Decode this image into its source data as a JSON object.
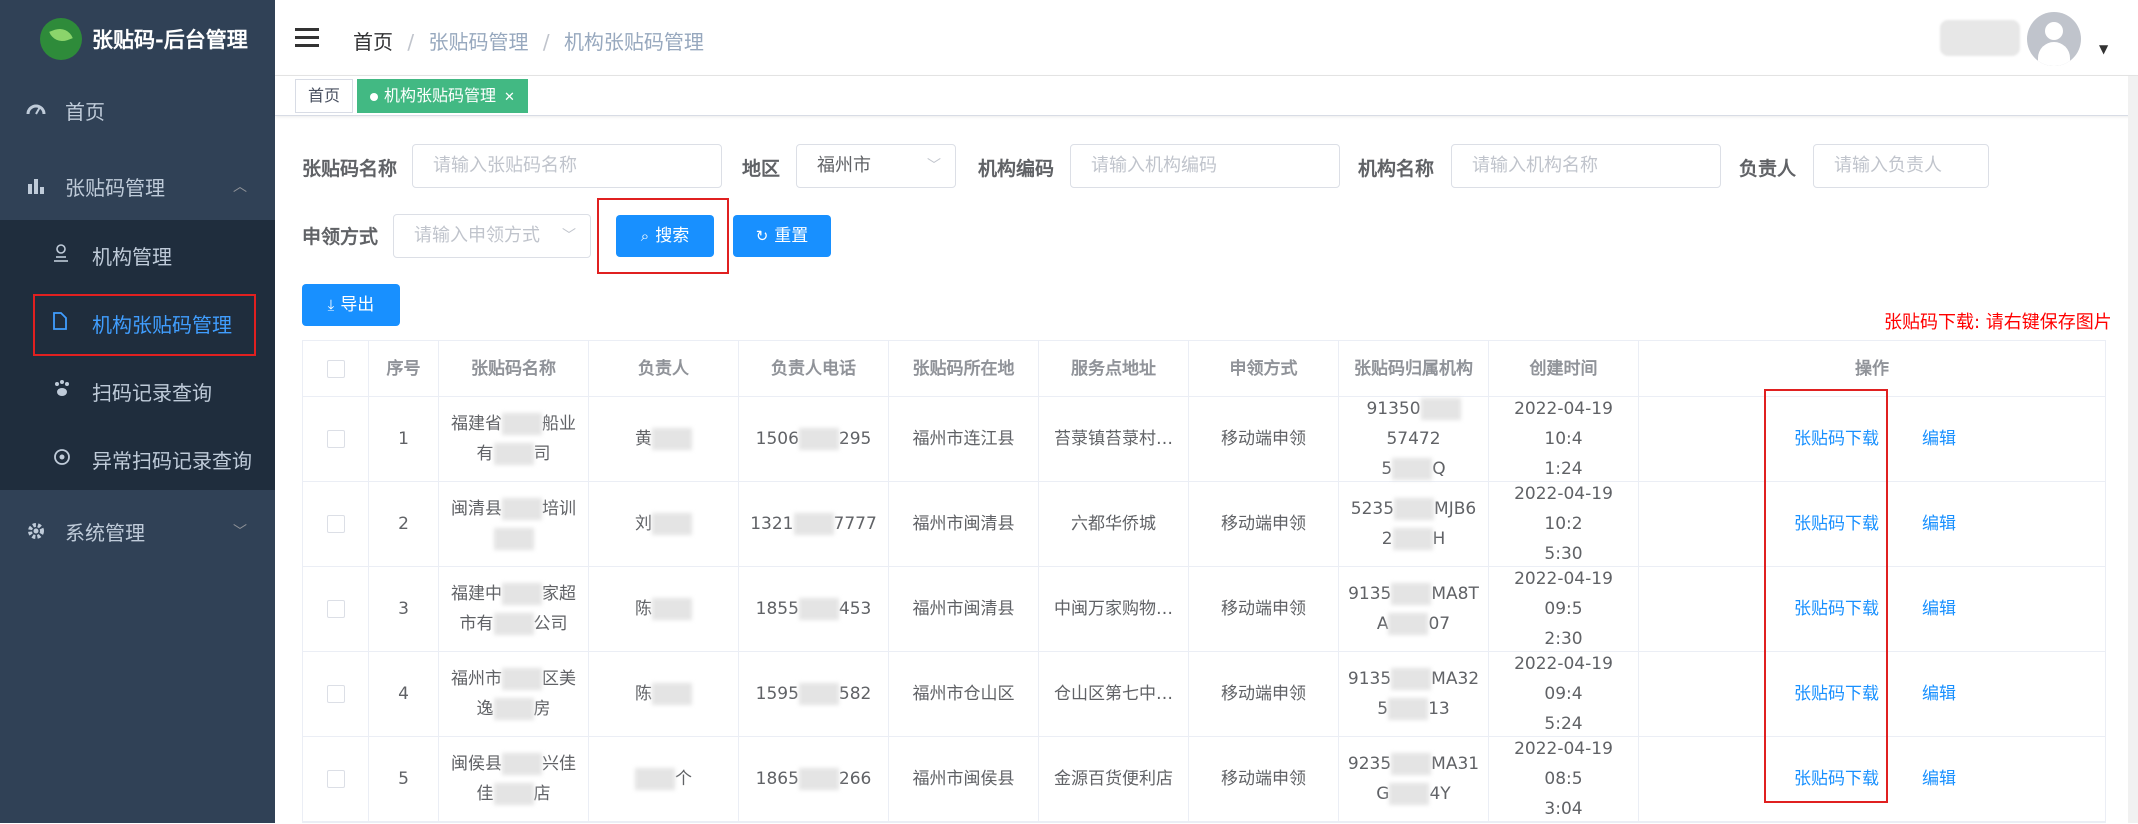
{
  "app": {
    "title": "张贴码-后台管理"
  },
  "sidebar": {
    "items": [
      {
        "label": "首页",
        "icon": "dashboard-icon"
      },
      {
        "label": "张贴码管理",
        "icon": "bar-chart-icon",
        "expanded": true
      },
      {
        "label": "系统管理",
        "icon": "gear-icon"
      }
    ],
    "subitems": [
      {
        "label": "机构管理",
        "icon": "user-icon"
      },
      {
        "label": "机构张贴码管理",
        "icon": "document-icon",
        "active": true
      },
      {
        "label": "扫码记录查询",
        "icon": "paw-icon"
      },
      {
        "label": "异常扫码记录查询",
        "icon": "scan-icon"
      }
    ]
  },
  "header": {
    "breadcrumb": [
      "首页",
      "张贴码管理",
      "机构张贴码管理"
    ]
  },
  "tags": [
    {
      "label": "首页"
    },
    {
      "label": "机构张贴码管理",
      "active": true
    }
  ],
  "form": {
    "name_label": "张贴码名称",
    "name_placeholder": "请输入张贴码名称",
    "region_label": "地区",
    "region_value": "福州市",
    "code_label": "机构编码",
    "code_placeholder": "请输入机构编码",
    "org_label": "机构名称",
    "org_placeholder": "请输入机构名称",
    "person_label": "负责人",
    "person_placeholder": "请输入负责人",
    "apply_label": "申领方式",
    "apply_placeholder": "请输入申领方式",
    "search_btn": "搜索",
    "reset_btn": "重置",
    "export_btn": "导出"
  },
  "notice": "张贴码下载: 请右键保存图片",
  "table": {
    "columns": [
      "序号",
      "张贴码名称",
      "负责人",
      "负责人电话",
      "张贴码所在地",
      "服务点地址",
      "申领方式",
      "张贴码归属机构",
      "创建时间",
      "操作"
    ],
    "download_label": "张贴码下载",
    "edit_label": "编辑",
    "rows": [
      {
        "no": "1",
        "name1": "福建省",
        "name2": "船业",
        "name3": "有",
        "name4": "司",
        "person1": "黄",
        "person2": "",
        "phone1": "1506",
        "phone2": "295",
        "location": "福州市连江县",
        "address": "苔菉镇苔菉村…",
        "apply": "移动端申领",
        "org1": "91350",
        "org2": "57472",
        "org3": "5",
        "org4": "Q",
        "time1": "2022-04-19 10:4",
        "time2": "1:24"
      },
      {
        "no": "2",
        "name1": "闽清县",
        "name2": "培训",
        "name3": "",
        "name4": "",
        "person1": "刘",
        "person2": "",
        "phone1": "1321",
        "phone2": "7777",
        "location": "福州市闽清县",
        "address": "六都华侨城",
        "apply": "移动端申领",
        "org1": "5235",
        "org2": "MJB6",
        "org3": "2",
        "org4": "H",
        "time1": "2022-04-19 10:2",
        "time2": "5:30"
      },
      {
        "no": "3",
        "name1": "福建中",
        "name2": "家超",
        "name3": "市有",
        "name4": "公司",
        "person1": "陈",
        "person2": "",
        "phone1": "1855",
        "phone2": "453",
        "location": "福州市闽清县",
        "address": "中闽万家购物…",
        "apply": "移动端申领",
        "org1": "9135",
        "org2": "MA8T",
        "org3": "A",
        "org4": "07",
        "time1": "2022-04-19 09:5",
        "time2": "2:30"
      },
      {
        "no": "4",
        "name1": "福州市",
        "name2": "区美",
        "name3": "逸",
        "name4": "房",
        "person1": "陈",
        "person2": "",
        "phone1": "1595",
        "phone2": "582",
        "location": "福州市仓山区",
        "address": "仓山区第七中…",
        "apply": "移动端申领",
        "org1": "9135",
        "org2": "MA32",
        "org3": "5",
        "org4": "13",
        "time1": "2022-04-19 09:4",
        "time2": "5:24"
      },
      {
        "no": "5",
        "name1": "闽侯县",
        "name2": "兴佳",
        "name3": "佳",
        "name4": "店",
        "person1": "",
        "person2": "个",
        "phone1": "1865",
        "phone2": "266",
        "location": "福州市闽侯县",
        "address": "金源百货便利店",
        "apply": "移动端申领",
        "org1": "9235",
        "org2": "MA31",
        "org3": "G",
        "org4": "4Y",
        "time1": "2022-04-19 08:5",
        "time2": "3:04"
      }
    ]
  }
}
